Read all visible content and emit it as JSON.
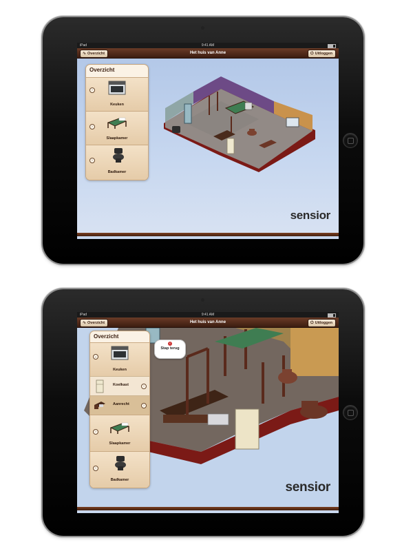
{
  "screens": [
    {
      "status": {
        "carrier": "iPad",
        "time": "9:41 AM"
      },
      "nav": {
        "left": "Overzicht",
        "title": "Het huis van Anne",
        "right": "Uitloggen"
      },
      "sidebar": {
        "title": "Overzicht",
        "items": [
          {
            "label": "Keuken"
          },
          {
            "label": "Slaapkamer"
          },
          {
            "label": "Badkamer"
          }
        ]
      },
      "logo": "sensior"
    },
    {
      "status": {
        "carrier": "iPad",
        "time": "9:41 AM"
      },
      "nav": {
        "left": "Overzicht",
        "title": "Het huis van Anne",
        "right": "Uitloggen"
      },
      "sidebar": {
        "title": "Overzicht",
        "items": [
          {
            "label": "Keuken"
          },
          {
            "label": "Slaapkamer"
          },
          {
            "label": "Badkamer"
          }
        ],
        "subitems": [
          {
            "label": "Koelkast"
          },
          {
            "label": "Aanrecht"
          }
        ]
      },
      "back_button": "Stap terug",
      "logo": "sensior"
    }
  ]
}
